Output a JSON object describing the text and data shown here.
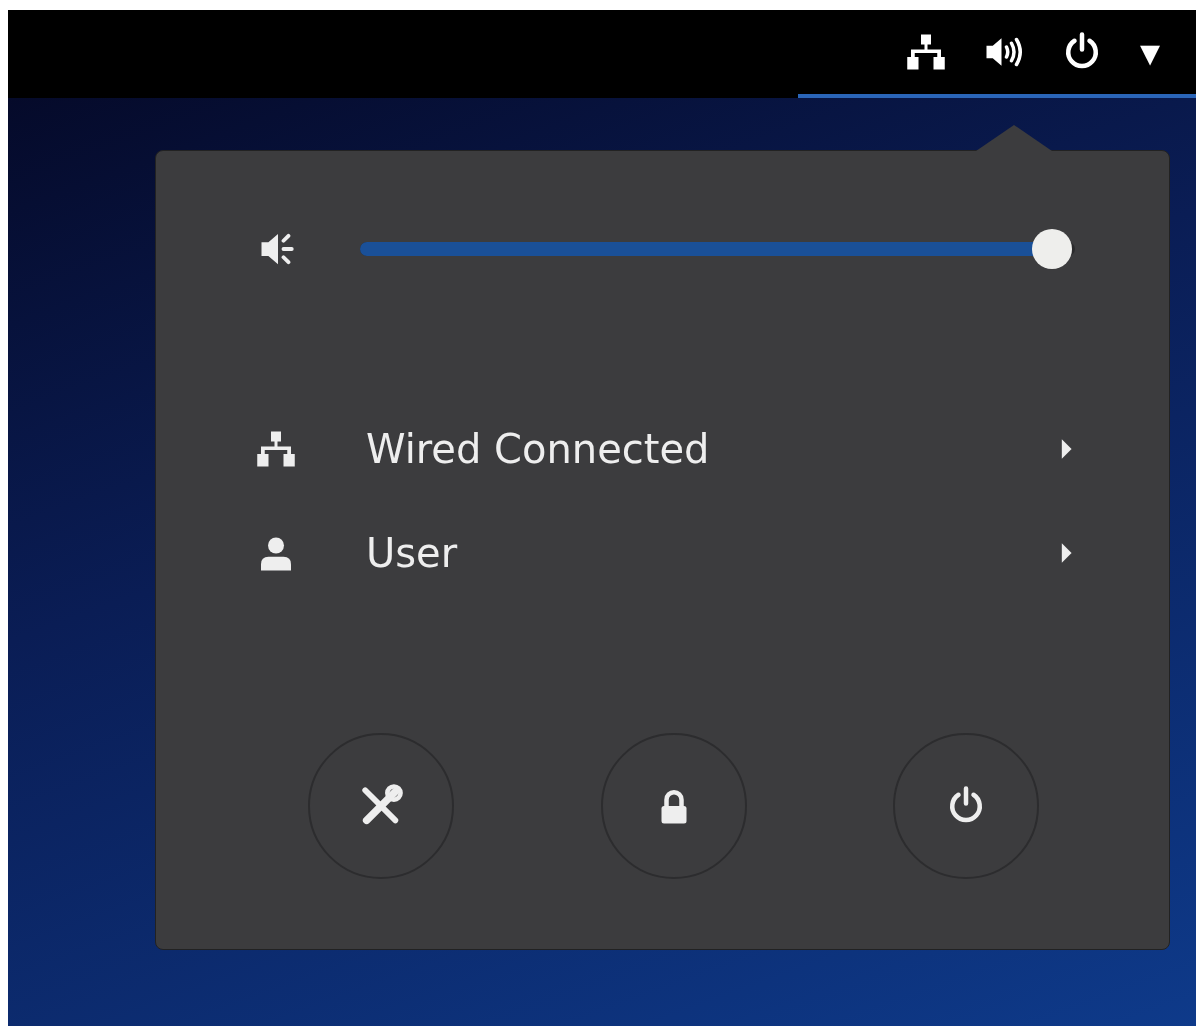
{
  "top_bar": {
    "indicators_active": true,
    "dropdown": "▾"
  },
  "volume": {
    "level": 0.99
  },
  "menu_items": [
    {
      "kind": "network",
      "label": "Wired Connected",
      "expanded": false
    },
    {
      "kind": "user",
      "label": "User",
      "expanded": false
    }
  ],
  "action_buttons": [
    {
      "kind": "settings"
    },
    {
      "kind": "lock"
    },
    {
      "kind": "power"
    }
  ]
}
